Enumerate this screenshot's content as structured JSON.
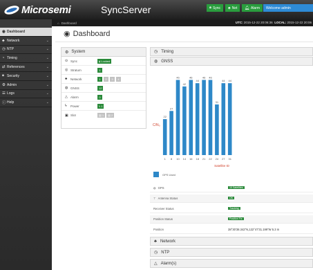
{
  "header": {
    "logo": "Microsemi",
    "title": "SyncServer",
    "status_buttons": [
      {
        "label": "Sync",
        "icon": "lock-icon"
      },
      {
        "label": "Net",
        "icon": "network-icon"
      },
      {
        "label": "Alarm",
        "icon": "alarm-icon"
      }
    ],
    "welcome": "Welcome admin"
  },
  "breadcrumb": {
    "home": "Dashboard",
    "utc_label": "UTC:",
    "utc_value": "2015-12-22 20:06:36",
    "local_label": "LOCAL:",
    "local_value": "2015-12-22 20:06"
  },
  "sidebar": {
    "items": [
      {
        "label": "Dashboard",
        "icon": "dashboard-icon",
        "active": true
      },
      {
        "label": "Network",
        "icon": "network-icon"
      },
      {
        "label": "NTP",
        "icon": "clock-icon"
      },
      {
        "label": "Timing",
        "icon": "timing-icon"
      },
      {
        "label": "References",
        "icon": "references-icon"
      },
      {
        "label": "Security",
        "icon": "lock-icon"
      },
      {
        "label": "Admin",
        "icon": "admin-icon"
      },
      {
        "label": "Logs",
        "icon": "logs-icon"
      },
      {
        "label": "Help",
        "icon": "help-icon"
      }
    ]
  },
  "page": {
    "title": "Dashboard"
  },
  "system": {
    "title": "System",
    "rows": [
      {
        "label": "Sync",
        "badges": [
          {
            "text": "Locked",
            "style": "green"
          }
        ]
      },
      {
        "label": "Stratum",
        "badges": [
          {
            "text": "1",
            "style": "green"
          }
        ]
      },
      {
        "label": "Network",
        "badges": [
          {
            "text": "1",
            "style": "green"
          },
          {
            "text": "2",
            "style": "grey"
          },
          {
            "text": "3",
            "style": "grey"
          },
          {
            "text": "4",
            "style": "grey"
          }
        ]
      },
      {
        "label": "GNSS",
        "badges": [
          {
            "text": "12",
            "style": "green"
          }
        ]
      },
      {
        "label": "Alarm",
        "badges": [
          {
            "text": "0",
            "style": "green"
          }
        ]
      },
      {
        "label": "Power",
        "badges": [
          {
            "text": "1",
            "style": "green"
          }
        ]
      },
      {
        "label": "Slot",
        "badges": [
          {
            "text": "1",
            "style": "grey"
          },
          {
            "text": "2",
            "style": "grey"
          }
        ]
      }
    ]
  },
  "timing": {
    "title": "Timing"
  },
  "gnss": {
    "title": "GNSS"
  },
  "chart_data": {
    "type": "bar",
    "categories": [
      "1",
      "8",
      "10",
      "14",
      "16",
      "18",
      "21",
      "22",
      "24",
      "27",
      "31"
    ],
    "values": [
      22,
      27,
      46,
      42,
      46,
      44,
      46,
      46,
      31,
      44
    ],
    "x": [
      1,
      8,
      10,
      14,
      16,
      18,
      21,
      22,
      24,
      27,
      31
    ],
    "bars": [
      {
        "sat": "1",
        "value": 22
      },
      {
        "sat": "8",
        "value": 27
      },
      {
        "sat": "10",
        "value": 46
      },
      {
        "sat": "14",
        "value": 42
      },
      {
        "sat": "16",
        "value": 46
      },
      {
        "sat": "18",
        "value": 44
      },
      {
        "sat": "21",
        "value": 46
      },
      {
        "sat": "22",
        "value": 46
      },
      {
        "sat": "24",
        "value": 31
      },
      {
        "sat": "27",
        "value": 44
      },
      {
        "sat": "31",
        "value": 44
      }
    ],
    "ylabel": "C/N₀",
    "xlabel": "Satellite ID",
    "ylim": [
      0,
      50
    ],
    "legend": "GPS Used",
    "legend_position": "bottom-left",
    "color": "#2e88c8"
  },
  "gps": {
    "rows": [
      {
        "label": "GPS",
        "value": "10 Satellites",
        "badge": true,
        "icon": "gps-icon"
      },
      {
        "label": "Antenna Status",
        "value": "OK",
        "badge": true,
        "icon": "antenna-icon"
      },
      {
        "label": "Receiver Status",
        "value": "Tracking",
        "badge": true
      },
      {
        "label": "Position Status",
        "value": "Position Fix",
        "badge": true
      },
      {
        "label": "Position",
        "value": "38°30'38.342\"N,122°47'31.199\"W  5.3 m",
        "badge": false
      }
    ]
  },
  "sections": [
    {
      "label": "Network",
      "icon": "network-icon"
    },
    {
      "label": "NTP",
      "icon": "clock-icon"
    },
    {
      "label": "Alarm(s)",
      "icon": "alarm-icon"
    }
  ]
}
